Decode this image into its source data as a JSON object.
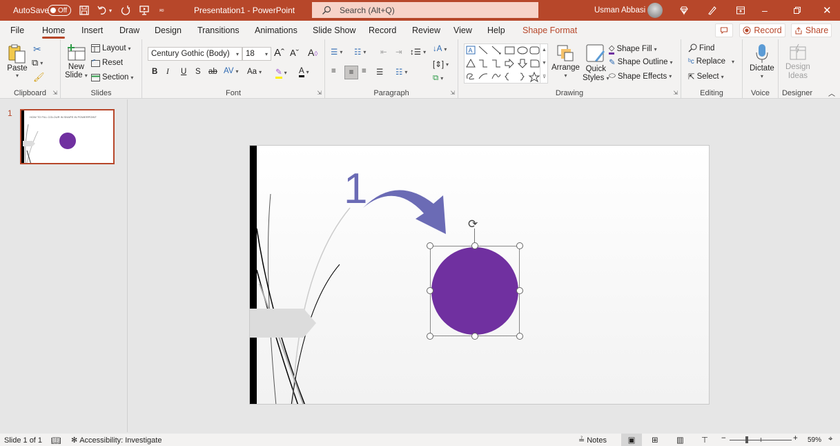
{
  "titlebar": {
    "autosave_label": "AutoSave",
    "autosave_state": "Off",
    "doc_title": "Presentation1  -  PowerPoint",
    "search_placeholder": "Search (Alt+Q)",
    "user_name": "Usman Abbasi",
    "brand_color": "#b7472a"
  },
  "menu": {
    "tabs": [
      "File",
      "Home",
      "Insert",
      "Draw",
      "Design",
      "Transitions",
      "Animations",
      "Slide Show",
      "Record",
      "Review",
      "View",
      "Help",
      "Shape Format"
    ],
    "active": "Home",
    "record_label": "Record",
    "share_label": "Share"
  },
  "ribbon": {
    "clipboard": {
      "label": "Clipboard",
      "paste": "Paste"
    },
    "slides": {
      "label": "Slides",
      "new_slide_1": "New",
      "new_slide_2": "Slide",
      "layout": "Layout",
      "reset": "Reset",
      "section": "Section"
    },
    "font": {
      "label": "Font",
      "font_name": "Century Gothic (Body)",
      "font_size": "18",
      "bold": "B",
      "italic": "I",
      "underline": "U",
      "shadow": "S",
      "strike": "ab",
      "spacing": "AV",
      "case": "Aa"
    },
    "paragraph": {
      "label": "Paragraph"
    },
    "drawing": {
      "label": "Drawing",
      "arrange": "Arrange",
      "quick_styles_1": "Quick",
      "quick_styles_2": "Styles",
      "shape_fill": "Shape Fill",
      "shape_outline": "Shape Outline",
      "shape_effects": "Shape Effects"
    },
    "editing": {
      "label": "Editing",
      "find": "Find",
      "replace": "Replace",
      "select": "Select"
    },
    "voice": {
      "label": "Voice",
      "dictate": "Dictate"
    },
    "designer": {
      "label": "Designer",
      "design_ideas_1": "Design",
      "design_ideas_2": "Ideas"
    }
  },
  "thumbnails": [
    {
      "number": "1",
      "title": "HOW TO FILL COLOUR IN SHAPE IN POWERPOINT"
    }
  ],
  "slide": {
    "annotation_number": "1",
    "circle_color": "#7030a0",
    "arrow_color": "#6b6bb5"
  },
  "statusbar": {
    "slide_info": "Slide 1 of 1",
    "accessibility": "Accessibility: Investigate",
    "notes": "Notes",
    "zoom": "59%"
  }
}
